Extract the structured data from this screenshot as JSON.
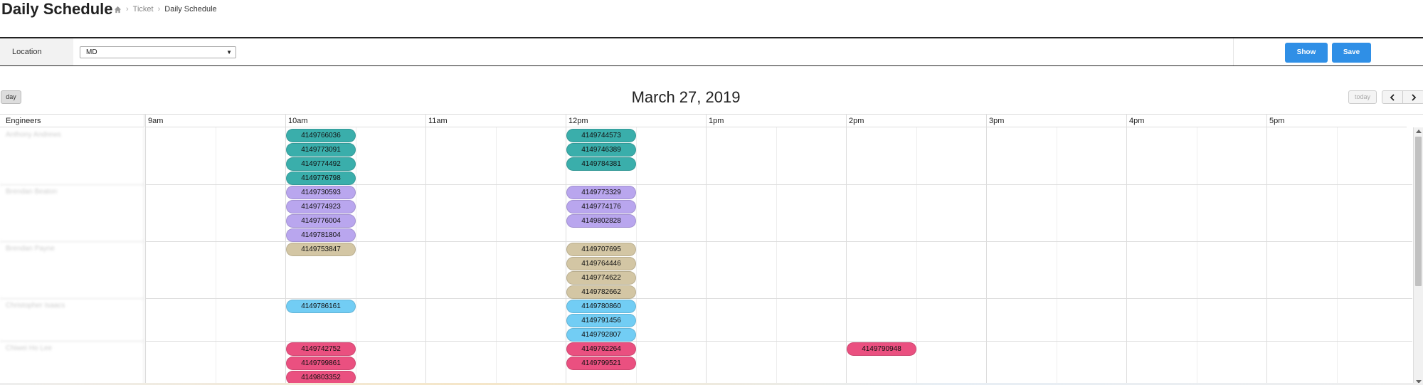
{
  "header": {
    "title": "Daily Schedule",
    "breadcrumb": [
      "Ticket",
      "Daily Schedule"
    ]
  },
  "filters": {
    "location_label": "Location",
    "location_value": "MD",
    "show_label": "Show",
    "save_label": "Save"
  },
  "calendar": {
    "view_label": "day",
    "date_title": "March 27, 2019",
    "today_label": "today",
    "resource_header": "Engineers",
    "time_slots": [
      "9am",
      "10am",
      "11am",
      "12pm",
      "1pm",
      "2pm",
      "3pm",
      "4pm",
      "5pm"
    ],
    "engineers": [
      {
        "name": "Anthony Andrews",
        "color": "#3aaeab",
        "events": [
          {
            "id": "4149766036",
            "start": "10:00",
            "row": 0
          },
          {
            "id": "4149773091",
            "start": "10:00",
            "row": 1
          },
          {
            "id": "4149774492",
            "start": "10:00",
            "row": 2
          },
          {
            "id": "4149776798",
            "start": "10:00",
            "row": 3
          },
          {
            "id": "4149744573",
            "start": "12:00",
            "row": 0
          },
          {
            "id": "4149746389",
            "start": "12:00",
            "row": 1
          },
          {
            "id": "4149784381",
            "start": "12:00",
            "row": 2
          }
        ]
      },
      {
        "name": "Brendan Beaton",
        "color": "#b9a6ee",
        "events": [
          {
            "id": "4149730593",
            "start": "10:00",
            "row": 0
          },
          {
            "id": "4149774923",
            "start": "10:00",
            "row": 1
          },
          {
            "id": "4149776004",
            "start": "10:00",
            "row": 2
          },
          {
            "id": "4149781804",
            "start": "10:00",
            "row": 3
          },
          {
            "id": "4149773329",
            "start": "12:00",
            "row": 0
          },
          {
            "id": "4149774176",
            "start": "12:00",
            "row": 1
          },
          {
            "id": "4149802828",
            "start": "12:00",
            "row": 2
          }
        ]
      },
      {
        "name": "Brendan Payne",
        "color": "#d3c6a4",
        "events": [
          {
            "id": "4149753847",
            "start": "10:00",
            "row": 0
          },
          {
            "id": "4149707695",
            "start": "12:00",
            "row": 0
          },
          {
            "id": "4149764446",
            "start": "12:00",
            "row": 1
          },
          {
            "id": "4149774622",
            "start": "12:00",
            "row": 2
          },
          {
            "id": "4149782662",
            "start": "12:00",
            "row": 3
          }
        ]
      },
      {
        "name": "Christopher Isaacs",
        "color": "#72cdf4",
        "events": [
          {
            "id": "4149786161",
            "start": "10:00",
            "row": 0
          },
          {
            "id": "4149780860",
            "start": "12:00",
            "row": 0
          },
          {
            "id": "4149791456",
            "start": "12:00",
            "row": 1
          },
          {
            "id": "4149792807",
            "start": "12:00",
            "row": 2
          }
        ]
      },
      {
        "name": "Chiwei Ho Lee",
        "color": "#ea5080",
        "events": [
          {
            "id": "4149742752",
            "start": "10:00",
            "row": 0
          },
          {
            "id": "4149799861",
            "start": "10:00",
            "row": 1
          },
          {
            "id": "4149803352",
            "start": "10:00",
            "row": 2
          },
          {
            "id": "4149762264",
            "start": "12:00",
            "row": 0
          },
          {
            "id": "4149799521",
            "start": "12:00",
            "row": 1
          },
          {
            "id": "4149790948",
            "start": "14:00",
            "row": 0
          }
        ]
      }
    ]
  }
}
